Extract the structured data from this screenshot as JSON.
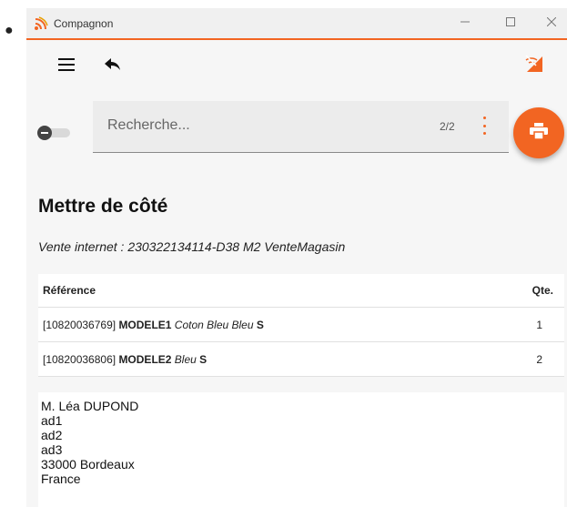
{
  "window": {
    "title": "Compagnon",
    "accent_color": "#f26522",
    "controls": [
      "minimize-icon",
      "maximize-icon",
      "close-icon"
    ]
  },
  "toolbar": {
    "icons": [
      "menu-icon",
      "reply-icon",
      "wifi-signal-icon"
    ]
  },
  "search": {
    "placeholder": "Recherche...",
    "value": "",
    "counter": "2/2"
  },
  "toggle": {
    "on": false
  },
  "fab": {
    "icon": "print-icon"
  },
  "page": {
    "title": "Mettre de côté",
    "subtitle": "Vente internet : 230322134114-D38 M2 VenteMagasin"
  },
  "table": {
    "headers": {
      "reference": "Référence",
      "quantity": "Qte."
    },
    "rows": [
      {
        "code": "[10820036769]",
        "model": "MODELE1",
        "desc": "Coton Bleu Bleu",
        "size": "S",
        "qty": "1"
      },
      {
        "code": "[10820036806]",
        "model": "MODELE2",
        "desc": "Bleu",
        "size": "S",
        "qty": "2"
      }
    ]
  },
  "address": {
    "lines": [
      "M. Léa DUPOND",
      "ad1",
      "ad2",
      "ad3",
      "33000 Bordeaux",
      "France"
    ]
  }
}
